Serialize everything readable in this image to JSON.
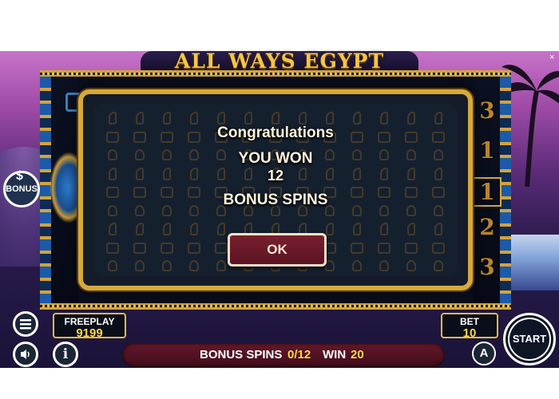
{
  "game": {
    "title": "ALL WAYS EGYPT"
  },
  "dialog": {
    "line1": "Congratulations",
    "line2": "YOU WON",
    "amount": "12",
    "line4": "BONUS SPINS",
    "ok_label": "OK"
  },
  "reels": {
    "right_numbers": [
      "3",
      "1",
      "1",
      "2",
      "3"
    ]
  },
  "controls": {
    "bonus_label": "BONUS",
    "bonus_symbol": "$",
    "menu_icon": "hamburger-menu-icon",
    "sound_icon": "speaker-icon",
    "info_icon": "info-icon",
    "info_symbol": "i",
    "start_label": "START",
    "auto_symbol": "A",
    "close_symbol": "×"
  },
  "freeplay": {
    "label": "FREEPLAY",
    "value": "9199"
  },
  "bet": {
    "label": "BET",
    "value": "10"
  },
  "status_bar": {
    "bonus_spins_label": "BONUS SPINS",
    "bonus_spins_value": "0/12",
    "win_label": "WIN",
    "win_value": "20"
  },
  "colors": {
    "gold": "#d6a93a",
    "value_yellow": "#ffd54a",
    "button_maroon": "#6a1a29",
    "dialog_bg": "#15202f"
  }
}
